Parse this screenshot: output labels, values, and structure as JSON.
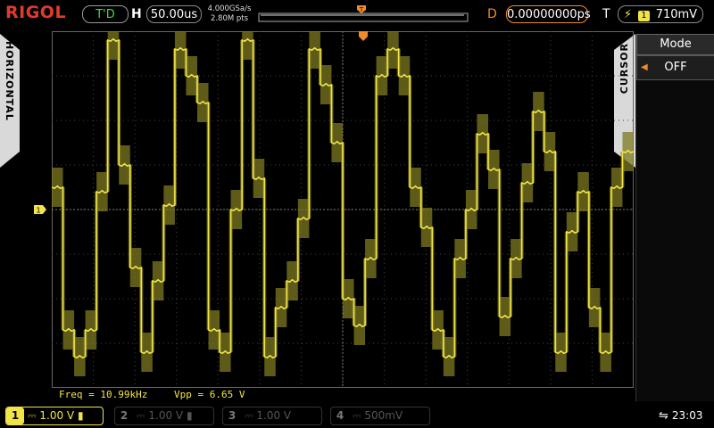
{
  "brand": "RIGOL",
  "header": {
    "run_status": "T'D",
    "horizontal_label": "H",
    "timebase": "50.00us",
    "sample_rate": "4.000GSa/s",
    "memory_depth": "2.80M pts",
    "delay_label": "D",
    "delay_value": "0.00000000ps",
    "trigger_label": "T",
    "trigger_level": "710mV"
  },
  "side_tabs": {
    "left": "HORIZONTAL",
    "right": "CURSOR"
  },
  "menu": {
    "item_label": "Mode",
    "item_value": "OFF"
  },
  "measurements": {
    "freq": "Freq = 10.99kHz",
    "vpp": "Vpp = 6.65 V"
  },
  "channels": [
    {
      "num": "1",
      "scale": "1.00 V",
      "active": true
    },
    {
      "num": "2",
      "scale": "1.00 V",
      "active": false
    },
    {
      "num": "3",
      "scale": "1.00 V",
      "active": false
    },
    {
      "num": "4",
      "scale": "500mV",
      "active": false
    }
  ],
  "clock": "23:03",
  "colors": {
    "trace": "#f1e44a",
    "envelope": "#7d7a20",
    "brand": "#e23b2e",
    "accent": "#f08a2a"
  },
  "chart_data": {
    "type": "line",
    "grid_divisions": {
      "x": 14,
      "y": 8
    },
    "series": [
      {
        "values": [
          0.5,
          -2.7,
          -3.3,
          -2.7,
          0.4,
          3.8,
          1.0,
          -1.3,
          -3.2,
          -1.6,
          0.1,
          3.6,
          3.0,
          2.4,
          -2.7,
          -3.2,
          0.0,
          3.8,
          0.7,
          -3.3,
          -2.2,
          -1.6,
          -0.2,
          3.6,
          2.8,
          1.5,
          -2.0,
          -2.6,
          -1.1,
          3.0,
          3.6,
          3.0,
          0.5,
          -0.4,
          -2.7,
          -3.3,
          -1.1,
          0.0,
          1.7,
          0.9,
          -2.4,
          -1.1,
          0.6,
          2.2,
          1.3,
          -3.2,
          -0.5,
          0.4,
          -2.2,
          -3.2,
          0.5,
          1.3
        ]
      }
    ]
  }
}
